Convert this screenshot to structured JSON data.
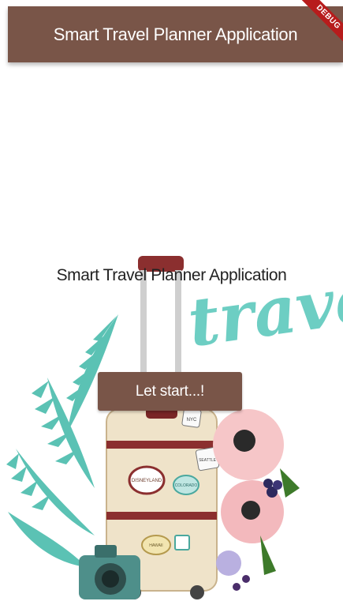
{
  "appbar": {
    "title": "Smart Travel Planner Application"
  },
  "debug_banner": {
    "label": "DEBUG",
    "color": "#b71c1c"
  },
  "main": {
    "title": "Smart Travel Planner Application",
    "start_button_label": "Let start...!"
  },
  "illustration": {
    "word": "travel",
    "word_color": "#5ec9bd",
    "sticker_labels": [
      "DISNEYLAND",
      "COLORADO",
      "HAWAII",
      "SEATTLE",
      "NYC"
    ]
  },
  "colors": {
    "primary": "#795548",
    "background": "#ffffff"
  }
}
